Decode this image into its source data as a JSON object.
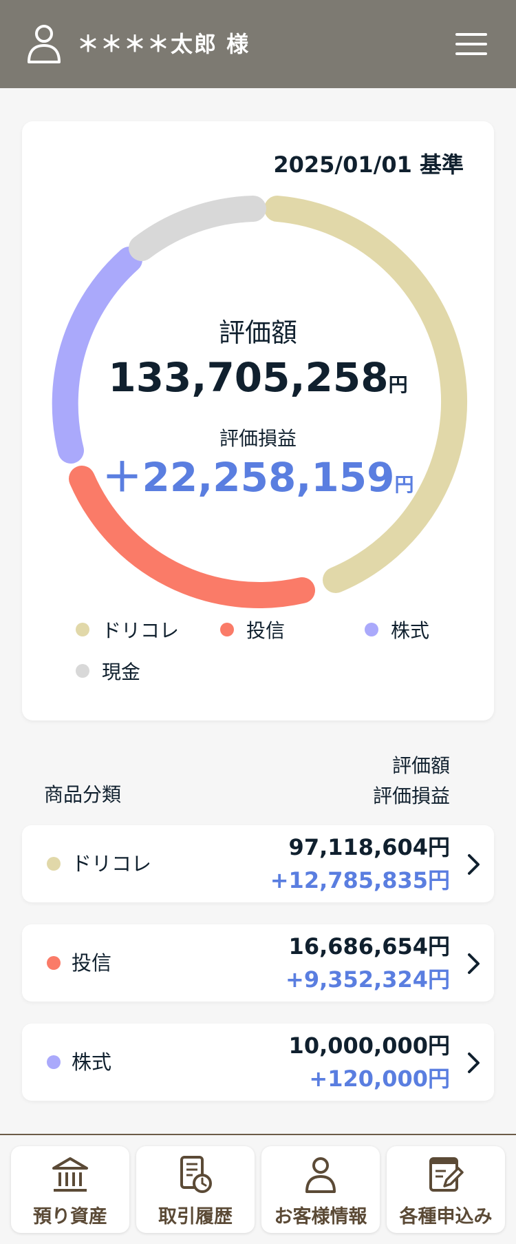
{
  "header": {
    "user_name": "＊＊＊＊太郎 様",
    "user_icon": "user-icon",
    "menu_icon": "hamburger-menu-icon",
    "background_color": "#7d7a72"
  },
  "summary": {
    "as_of": "2025/01/01 基準",
    "eval_label": "評価額",
    "eval_value": "133,705,258",
    "eval_unit": "円",
    "gain_label": "評価損益",
    "gain_value": "＋22,258,159",
    "gain_unit": "円"
  },
  "legend": [
    {
      "label": "ドリコレ",
      "color": "#e1d8a9"
    },
    {
      "label": "投信",
      "color": "#fa7b68"
    },
    {
      "label": "株式",
      "color": "#aaa9fb"
    },
    {
      "label": "現金",
      "color": "#d8d8d8"
    }
  ],
  "table_header": {
    "category": "商品分類",
    "eval": "評価額",
    "gain": "評価損益"
  },
  "products": [
    {
      "name": "ドリコレ",
      "value": "97,118,604円",
      "gain": "+12,785,835円",
      "color": "#e1d8a9"
    },
    {
      "name": "投信",
      "value": "16,686,654円",
      "gain": "+9,352,324円",
      "color": "#fa7b68"
    },
    {
      "name": "株式",
      "value": "10,000,000円",
      "gain": "+120,000円",
      "color": "#aaa9fb"
    }
  ],
  "bottom_nav": [
    {
      "label": "預り資産",
      "icon": "bank-icon"
    },
    {
      "label": "取引履歴",
      "icon": "history-document-icon"
    },
    {
      "label": "お客様情報",
      "icon": "customer-icon"
    },
    {
      "label": "各種申込み",
      "icon": "application-pen-icon"
    }
  ],
  "accent_color": "#5a7ee0"
}
